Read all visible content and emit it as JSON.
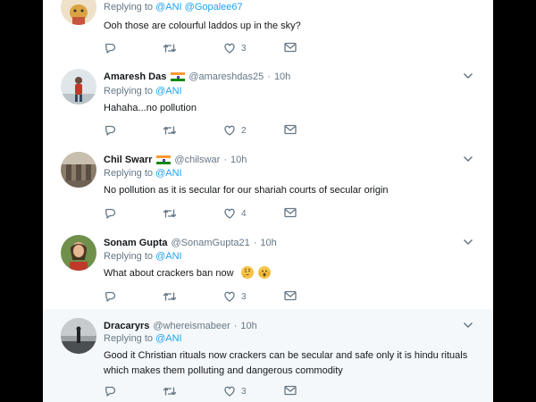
{
  "tweets": [
    {
      "name": "",
      "handle": "",
      "time": "",
      "replying_prefix": "Replying to ",
      "replying_to": "@ANI @Gopalee67",
      "text": "Ooh those are colourful laddos up in the sky?",
      "reply_count": "",
      "retweet_count": "",
      "like_count": "3"
    },
    {
      "name": "Amaresh Das",
      "handle": "@amareshdas25",
      "time": "10h",
      "replying_prefix": "Replying to ",
      "replying_to": "@ANI",
      "text": "Hahaha...no pollution",
      "reply_count": "",
      "retweet_count": "",
      "like_count": "2"
    },
    {
      "name": "Chil Swarr",
      "handle": "@chilswar",
      "time": "10h",
      "replying_prefix": "Replying to ",
      "replying_to": "@ANI",
      "text": "No pollution as it is secular for our shariah courts of secular origin",
      "reply_count": "",
      "retweet_count": "",
      "like_count": "4"
    },
    {
      "name": "Sonam Gupta",
      "handle": "@SonamGupta21",
      "time": "10h",
      "replying_prefix": "Replying to ",
      "replying_to": "@ANI",
      "text": "What about crackers ban now",
      "reply_count": "",
      "retweet_count": "",
      "like_count": "3"
    },
    {
      "name": "Dracaryrs",
      "handle": "@whereismabeer",
      "time": "10h",
      "replying_prefix": "Replying to ",
      "replying_to": "@ANI",
      "text": "Good it  Christian rituals now  crackers can be secular and safe only it is hindu rituals which  makes them polluting and dangerous commodity",
      "reply_count": "",
      "retweet_count": "",
      "like_count": "3"
    }
  ],
  "icons": {
    "reply": "reply-icon",
    "retweet": "retweet-icon",
    "like": "heart-icon",
    "dm": "envelope-icon",
    "caret": "chevron-down-icon",
    "flag": "india-flag-icon",
    "emoji_thinking": "thinking-face-icon",
    "emoji_astonished": "astonished-face-icon"
  },
  "colors": {
    "link": "#1da1f2",
    "muted": "#657786",
    "divider": "#e6ecf0",
    "highlight_bg": "#f5f8fa"
  }
}
